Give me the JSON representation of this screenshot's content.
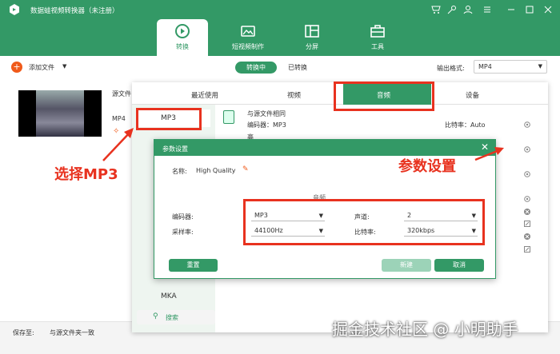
{
  "window": {
    "title": "数据蛙视频转换器（未注册）"
  },
  "nav": {
    "tabs": [
      {
        "label": "转换",
        "icon": "convert-icon"
      },
      {
        "label": "短视频制作",
        "icon": "video-maker-icon"
      },
      {
        "label": "分屏",
        "icon": "split-screen-icon"
      },
      {
        "label": "工具",
        "icon": "toolbox-icon"
      }
    ]
  },
  "toolbar": {
    "add_file": "添加文件",
    "seg_converting": "转换中",
    "seg_converted": "已转换",
    "output_format_label": "输出格式:",
    "output_format_value": "MP4"
  },
  "file": {
    "source_label": "源文件",
    "format": "MP4"
  },
  "bottom": {
    "save_to_label": "保存至:",
    "save_to_value": "与源文件夹一致"
  },
  "format_panel": {
    "tabs": [
      "最近使用",
      "视频",
      "音频",
      "设备"
    ],
    "active_tab": "音频",
    "list": {
      "first": "MP3",
      "last": "MKA"
    },
    "search": "搜索",
    "quality_row": {
      "name": "与源文件相同",
      "encoder": "编码器：MP3",
      "bitrate": "比特率：Auto",
      "partial": "高"
    }
  },
  "dialog": {
    "title": "参数设置",
    "name_label": "名称:",
    "name_value": "High Quality",
    "section": "音频",
    "encoder_label": "编码器:",
    "encoder_value": "MP3",
    "samplerate_label": "采样率:",
    "samplerate_value": "44100Hz",
    "channel_label": "声道:",
    "channel_value": "2",
    "bitrate_label": "比特率:",
    "bitrate_value": "320kbps",
    "reset_button": "重置",
    "new_button": "新建",
    "cancel_button": "取消"
  },
  "annotations": {
    "select_mp3": "选择MP3",
    "param_settings": "参数设置"
  },
  "watermark": "掘金技术社区 @ 小明助手",
  "colors": {
    "accent": "#339966",
    "highlight": "#e8321f",
    "add": "#f05a1a"
  }
}
